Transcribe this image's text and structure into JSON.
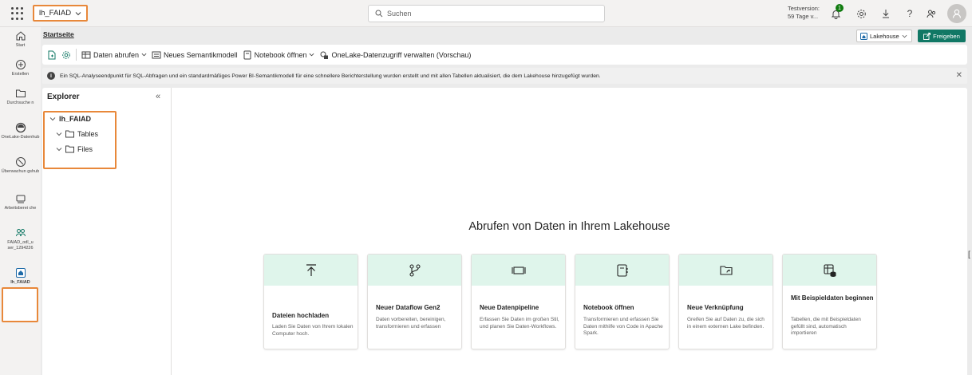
{
  "topbar": {
    "workspace_label": "lh_FAIAD",
    "search_placeholder": "Suchen",
    "trial_line1": "Testversion:",
    "trial_line2": "59 Tage v...",
    "notification_count": "1"
  },
  "rail": {
    "items": [
      {
        "label": "Start"
      },
      {
        "label": "Erstellen"
      },
      {
        "label": "Durchsuche n"
      },
      {
        "label": "OneLake-Datenhub"
      },
      {
        "label": "Überwachun gshub"
      },
      {
        "label": "Arbeitsberei che"
      },
      {
        "label": "FAIAD_odl_u ser_1294226"
      },
      {
        "label": "lh_FAIAD"
      }
    ]
  },
  "home": {
    "title": "Startseite",
    "lakehouse_label": "Lakehouse",
    "share_label": "Freigeben"
  },
  "ribbon": {
    "get_data": "Daten abrufen",
    "new_semantic_model": "Neues Semantikmodell",
    "open_notebook": "Notebook öffnen",
    "onelake_access": "OneLake-Datenzugriff verwalten (Vorschau)"
  },
  "infobar": {
    "message": "Ein SQL-Analyseendpunkt für SQL-Abfragen und ein standardmäßiges Power BI-Semantikmodell für eine schnellere Berichterstellung wurden erstellt und mit allen Tabellen aktualisiert, die dem Lakehouse hinzugefügt wurden."
  },
  "explorer": {
    "title": "Explorer",
    "root": "lh_FAIAD",
    "folders": [
      "Tables",
      "Files"
    ]
  },
  "main": {
    "heading": "Abrufen von Daten in Ihrem Lakehouse",
    "cards": [
      {
        "title": "Dateien hochladen",
        "desc": "Laden Sie Daten von Ihrem lokalen Computer hoch.",
        "icon": "upload-icon"
      },
      {
        "title": "Neuer Dataflow Gen2",
        "desc": "Daten vorbereiten, bereinigen, transformieren und erfassen",
        "icon": "dataflow-icon"
      },
      {
        "title": "Neue Datenpipeline",
        "desc": "Erfassen Sie Daten im großen Stil, und planen Sie Daten-Workflows.",
        "icon": "pipeline-icon"
      },
      {
        "title": "Notebook öffnen",
        "desc": "Transformieren und erfassen Sie Daten mithilfe von Code in Apache Spark.",
        "icon": "notebook-icon"
      },
      {
        "title": "Neue Verknüpfung",
        "desc": "Greifen Sie auf Daten zu, die sich in einem externen Lake befinden.",
        "icon": "shortcut-icon"
      },
      {
        "title": "Mit Beispieldaten beginnen",
        "desc": "Tabellen, die mit Beispieldaten gefüllt sind, automatisch importieren",
        "icon": "sample-data-icon"
      }
    ]
  },
  "colors": {
    "accent": "#117865",
    "highlight": "#e8883a",
    "card_header": "#dff5eb"
  }
}
